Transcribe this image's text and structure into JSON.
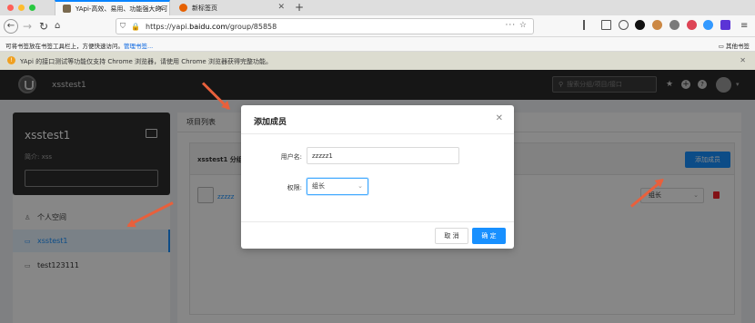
{
  "browser": {
    "tabs": [
      {
        "label": "YApi-高效、易用、功能强大的可",
        "active": true
      },
      {
        "label": "新标签页",
        "active": false
      }
    ],
    "url": {
      "prefix": "https://yapi.",
      "domain": "baidu.com",
      "path": "/group/85858"
    },
    "bookmarks_hint": "可将书签放在书签工具栏上，方便快速访问。",
    "bookmarks_manage": "管理书签...",
    "other_bookmarks": "其他书签",
    "notice": "YApi 的接口测试等功能仅支持 Chrome 浏览器，请使用 Chrome 浏览器获得完整功能。"
  },
  "app": {
    "title": "xsstest1",
    "search_placeholder": "搜索分组/项目/接口"
  },
  "sidebar": {
    "group_name": "xsstest1",
    "intro": "简介: xss",
    "items": [
      {
        "label": "个人空间",
        "icon": "user-icon"
      },
      {
        "label": "xsstest1",
        "icon": "folder-icon",
        "active": true
      },
      {
        "label": "test123111",
        "icon": "folder-icon"
      }
    ]
  },
  "main": {
    "tabs": [
      "项目列表"
    ],
    "panel_title": "xsstest1 分组成",
    "add_member_label": "添加成员",
    "member_name": "zzzzz",
    "member_role": "组长"
  },
  "modal": {
    "title": "添加成员",
    "username_label": "用户名:",
    "username_value": "zzzzz1",
    "role_label": "权限:",
    "role_value": "组长",
    "cancel_label": "取 消",
    "ok_label": "确 定"
  },
  "colors": {
    "accent": "#1890ff",
    "header_bg": "#2b2b2b",
    "arrow": "#e8603c"
  }
}
